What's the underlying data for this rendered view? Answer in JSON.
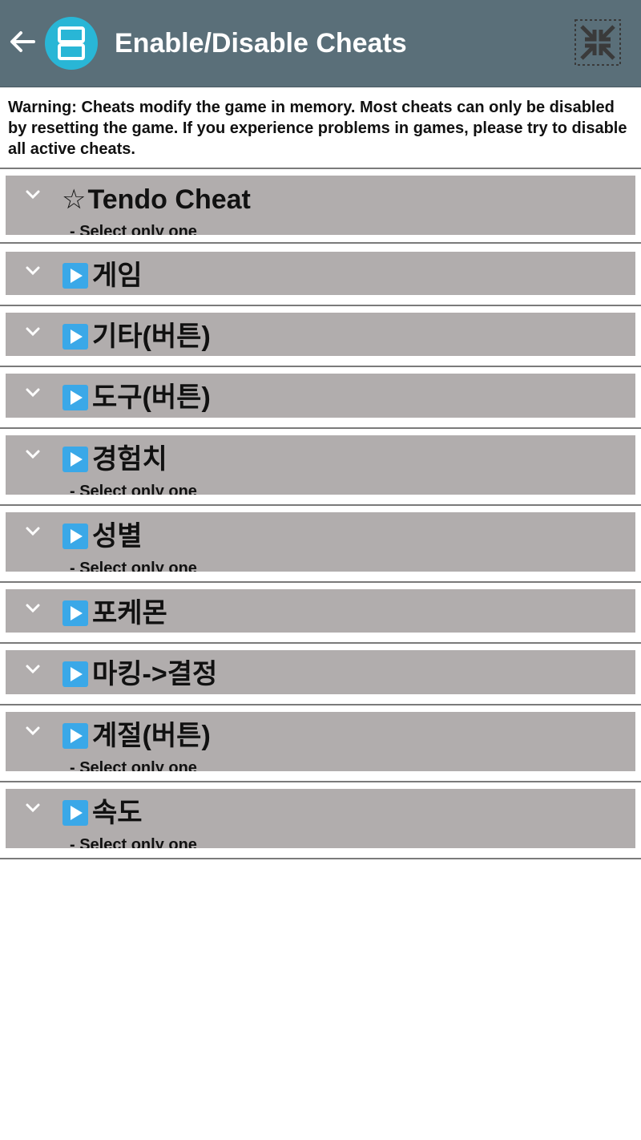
{
  "appbar": {
    "title": "Enable/Disable Cheats",
    "back_icon": "arrow-back-icon",
    "logo_icon": "nintendo-ds-icon",
    "fullscreen_icon": "exit-fullscreen-icon",
    "background": "#5a6f79",
    "logo_color": "#29b6d6"
  },
  "warning_text": "Warning: Cheats modify the game in memory. Most cheats can only be disabled by resetting the game. If you experience problems in games, please try to disable all active cheats.",
  "cheats": [
    {
      "prefix": "star",
      "title": "Tendo Cheat",
      "subtitle": "- Select only one"
    },
    {
      "prefix": "play",
      "title": "게임",
      "subtitle": ""
    },
    {
      "prefix": "play",
      "title": "기타(버튼)",
      "subtitle": ""
    },
    {
      "prefix": "play",
      "title": "도구(버튼)",
      "subtitle": ""
    },
    {
      "prefix": "play",
      "title": "경험치",
      "subtitle": "- Select only one"
    },
    {
      "prefix": "play",
      "title": "성별",
      "subtitle": "- Select only one"
    },
    {
      "prefix": "play",
      "title": "포케몬",
      "subtitle": ""
    },
    {
      "prefix": "play",
      "title": "마킹->결정",
      "subtitle": ""
    },
    {
      "prefix": "play",
      "title": "계절(버튼)",
      "subtitle": "- Select only one"
    },
    {
      "prefix": "play",
      "title": "속도",
      "subtitle": "- Select only one"
    }
  ],
  "icons": {
    "expand": "chevron-down-icon",
    "play": "play-button-icon",
    "star": "star-outline-icon"
  },
  "colors": {
    "item_background": "#b1adad",
    "divider": "#7a7a7a",
    "play_icon": "#3aa8e8"
  }
}
